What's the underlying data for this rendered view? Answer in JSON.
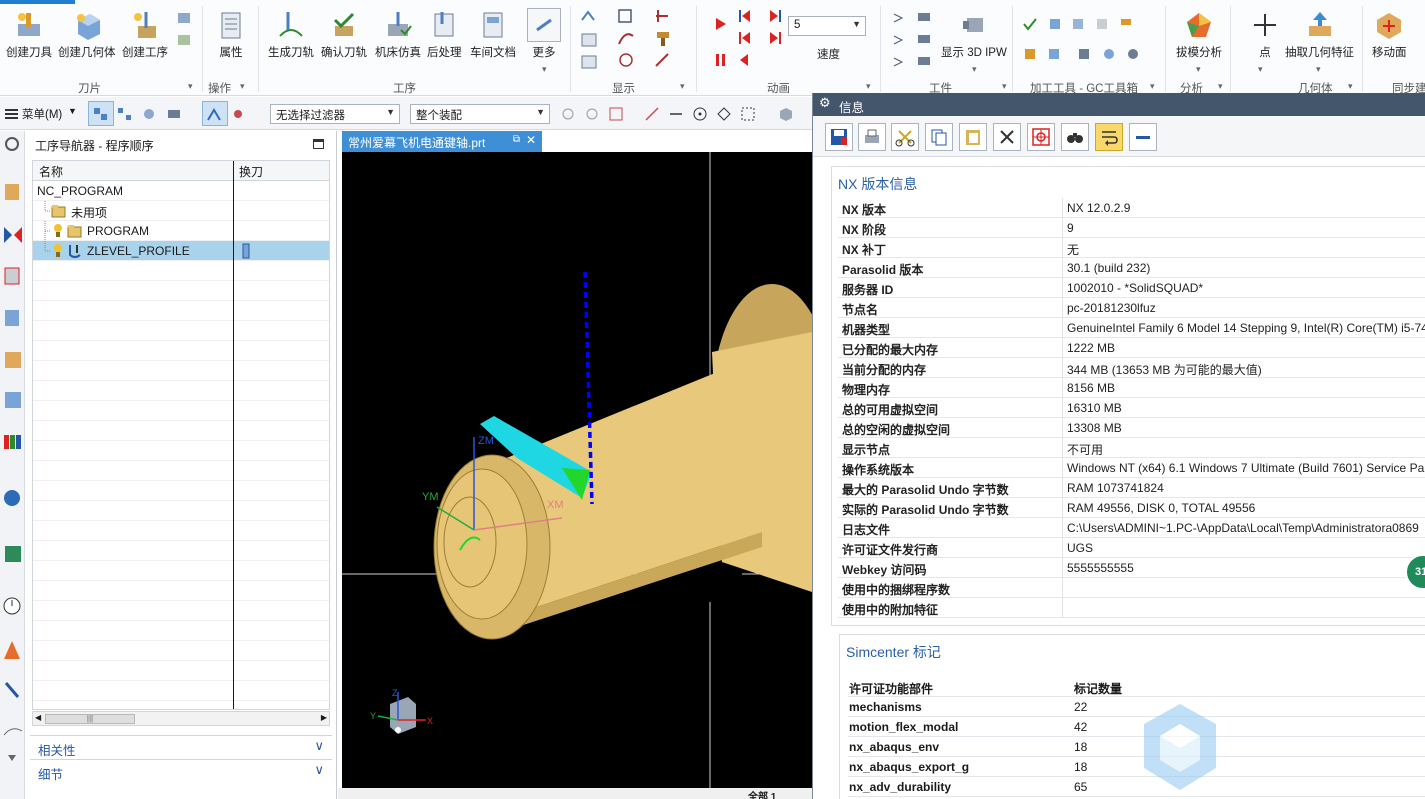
{
  "ribbon": {
    "group_cutter": "刀片",
    "group_ops": "操作",
    "group_operation": "工序",
    "group_display": "显示",
    "group_animation": "动画",
    "group_work": "工件",
    "group_gctools": "加工工具 - GC工具箱",
    "group_analysis": "分析",
    "group_geometry": "几何体",
    "group_sync": "同步建",
    "btn_create_tool": "创建刀具",
    "btn_create_geometry": "创建几何体",
    "btn_create_operation": "创建工序",
    "btn_properties": "属性",
    "btn_generate_path": "生成刀轨",
    "btn_confirm_path": "确认刀轨",
    "btn_machine_sim": "机床仿真",
    "btn_postprocess": "后处理",
    "btn_shop_doc": "车间文档",
    "btn_more": "更多",
    "speed_value": "5",
    "speed_label": "速度",
    "btn_show_ipw": "显示 3D IPW",
    "btn_draft_analysis": "拔模分析",
    "btn_point": "点",
    "btn_extract_geometry": "抽取几何特征",
    "btn_move_face": "移动面"
  },
  "cmdbar": {
    "menu_label": "菜单(M)",
    "filter_value": "无选择过滤器",
    "assembly_value": "整个装配"
  },
  "navigator": {
    "title": "工序导航器 - 程序顺序",
    "col_name": "名称",
    "col_toolchange": "换刀",
    "rows": [
      {
        "label": "NC_PROGRAM"
      },
      {
        "label": "未用项"
      },
      {
        "label": "PROGRAM"
      },
      {
        "label": "ZLEVEL_PROFILE"
      }
    ],
    "acc_related": "相关性",
    "acc_detail": "细节"
  },
  "tab": {
    "filename": "常州爱幕飞机电通键轴.prt"
  },
  "viewport": {
    "axis_zm": "ZM",
    "axis_ym": "YM",
    "axis_xm": "XM",
    "triad_x": "X",
    "triad_y": "Y",
    "triad_z": "Z"
  },
  "status": {
    "bottom_text": "全部 1"
  },
  "info": {
    "window_title": "信息",
    "section_title": "NX 版本信息",
    "rows": [
      {
        "k": "NX 版本",
        "v": "NX 12.0.2.9"
      },
      {
        "k": "NX 阶段",
        "v": "9"
      },
      {
        "k": "NX 补丁",
        "v": "无"
      },
      {
        "k": "Parasolid 版本",
        "v": "30.1 (build 232)"
      },
      {
        "k": "服务器 ID",
        "v": "1002010 - *SolidSQUAD*"
      },
      {
        "k": "节点名",
        "v": "pc-20181230lfuz"
      },
      {
        "k": "机器类型",
        "v": "GenuineIntel Family 6 Model 14 Stepping 9, Intel(R) Core(TM) i5-74"
      },
      {
        "k": "已分配的最大内存",
        "v": "1222 MB"
      },
      {
        "k": "当前分配的内存",
        "v": "344 MB (13653 MB 为可能的最大值)"
      },
      {
        "k": "物理内存",
        "v": "8156 MB"
      },
      {
        "k": "总的可用虚拟空间",
        "v": "16310 MB"
      },
      {
        "k": "总的空闲的虚拟空间",
        "v": "13308 MB"
      },
      {
        "k": "显示节点",
        "v": "不可用"
      },
      {
        "k": "操作系统版本",
        "v": "Windows NT (x64) 6.1 Windows 7 Ultimate (Build 7601) Service Pa"
      },
      {
        "k": "最大的 Parasolid Undo 字节数",
        "v": "RAM 1073741824"
      },
      {
        "k": "实际的 Parasolid Undo 字节数",
        "v": "RAM 49556, DISK 0, TOTAL 49556"
      },
      {
        "k": "日志文件",
        "v": "C:\\Users\\ADMINI~1.PC-\\AppData\\Local\\Temp\\Administratora0869"
      },
      {
        "k": "许可证文件发行商",
        "v": "UGS"
      },
      {
        "k": "Webkey 访问码",
        "v": "5555555555"
      },
      {
        "k": "使用中的捆绑程序数",
        "v": ""
      },
      {
        "k": "使用中的附加特征",
        "v": ""
      }
    ],
    "section2_title": "Simcenter 标记",
    "col_component": "许可证功能部件",
    "col_count": "标记数量",
    "marks": [
      {
        "k": "mechanisms",
        "v": "22"
      },
      {
        "k": "motion_flex_modal",
        "v": "42"
      },
      {
        "k": "nx_abaqus_env",
        "v": "18"
      },
      {
        "k": "nx_abaqus_export_g",
        "v": "18"
      },
      {
        "k": "nx_adv_durability",
        "v": "65"
      }
    ],
    "badge": "31"
  },
  "colors": {
    "accent": "#1e7fd3",
    "selection": "#a8d3ea",
    "part": "#e8c87a",
    "toolpath": "#0000ff",
    "info_title": "#44566b"
  },
  "icons": [
    "gear-icon",
    "save-icon",
    "print-icon",
    "cut-icon",
    "copy-icon",
    "paste-icon",
    "delete-icon",
    "target-icon",
    "binoculars-icon",
    "wrap-icon",
    "minus-icon"
  ]
}
